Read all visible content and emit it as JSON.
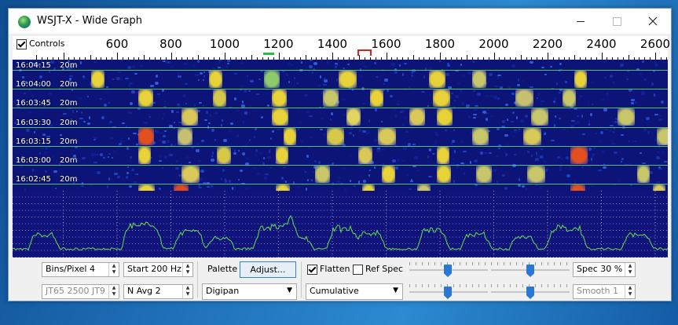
{
  "window": {
    "title": "WSJT-X - Wide Graph"
  },
  "titlebar": {
    "minimize_icon": "minimize-icon",
    "maximize_icon": "maximize-icon",
    "close_icon": "close-icon"
  },
  "controls": {
    "label": "Controls",
    "checked": true
  },
  "frequency_scale": {
    "labels": [
      "600",
      "800",
      "1000",
      "1200",
      "1400",
      "1600",
      "1800",
      "2000",
      "2200",
      "2400",
      "2600"
    ],
    "unit": "Hz"
  },
  "waterfall": {
    "band": "20m",
    "timestamps": [
      "16:04:15",
      "16:04:00",
      "16:03:45",
      "16:03:30",
      "16:03:15",
      "16:03:00",
      "16:02:45"
    ]
  },
  "bottom": {
    "bins_per_pixel": "Bins/Pixel  4",
    "start_freq": "Start 200 Hz",
    "mode_select": "JT65   2500   JT9",
    "n_avg": "N Avg 2",
    "palette_label": "Palette",
    "adjust_button": "Adjust...",
    "palette_value": "Digipan",
    "flatten_label": "Flatten",
    "flatten_checked": true,
    "ref_spec_label": "Ref Spec",
    "ref_spec_checked": false,
    "spectrum_mode": "Cumulative",
    "spec_percent": "Spec 30 %",
    "smooth": "Smooth  1"
  },
  "colors": {
    "waterfall_bg": "#0c1577",
    "grid_line": "#5fd36a",
    "spectrum_trace": "#63e04a",
    "accent": "#2a77d6"
  }
}
